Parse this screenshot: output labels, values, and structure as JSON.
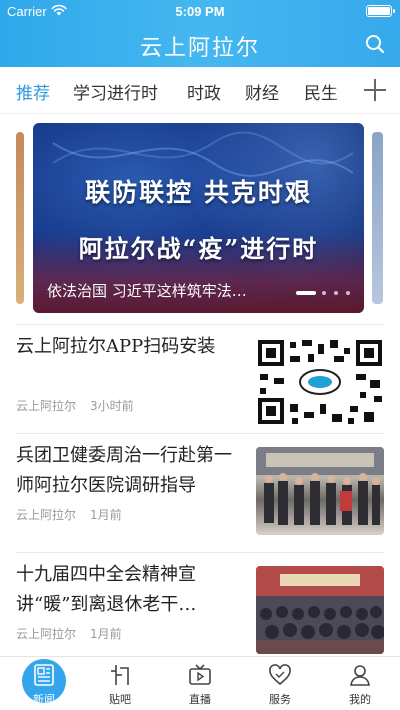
{
  "status_bar": {
    "carrier": "Carrier",
    "time": "5:09 PM"
  },
  "header": {
    "title": "云上阿拉尔",
    "search_icon": "search-icon"
  },
  "tabs": {
    "items": [
      {
        "label": "推荐",
        "active": true
      },
      {
        "label": "学习进行时",
        "active": false
      },
      {
        "label": "时政",
        "active": false
      },
      {
        "label": "财经",
        "active": false
      },
      {
        "label": "民生",
        "active": false
      }
    ],
    "add_icon": "plus-icon"
  },
  "carousel": {
    "banner_line1": "联防联控 共克时艰",
    "banner_line2": "阿拉尔战“疫”进行时",
    "caption": "依法治国 习近平这样筑牢法…",
    "slide_count": 4,
    "active_index": 0
  },
  "news": [
    {
      "title": "云上阿拉尔APP扫码安装",
      "source": "云上阿拉尔",
      "time": "3小时前",
      "thumbnail": "qr-code"
    },
    {
      "title": "兵团卫健委周治一行赴第一师阿拉尔医院调研指导",
      "source": "云上阿拉尔",
      "time": "1月前",
      "thumbnail": "photo"
    },
    {
      "title": "十九届四中全会精神宣讲“暖”到离退休老干…",
      "source": "云上阿拉尔",
      "time": "1月前",
      "thumbnail": "photo"
    }
  ],
  "bottom_nav": {
    "items": [
      {
        "label": "新闻",
        "icon": "news-icon",
        "active": true
      },
      {
        "label": "贴吧",
        "icon": "forum-icon",
        "active": false
      },
      {
        "label": "直播",
        "icon": "live-tv-icon",
        "active": false
      },
      {
        "label": "服务",
        "icon": "heart-icon",
        "active": false
      },
      {
        "label": "我的",
        "icon": "profile-icon",
        "active": false
      }
    ]
  },
  "colors": {
    "brand": "#2fa8ea",
    "active_tab": "#2a9be2",
    "meta_text": "#999999"
  }
}
